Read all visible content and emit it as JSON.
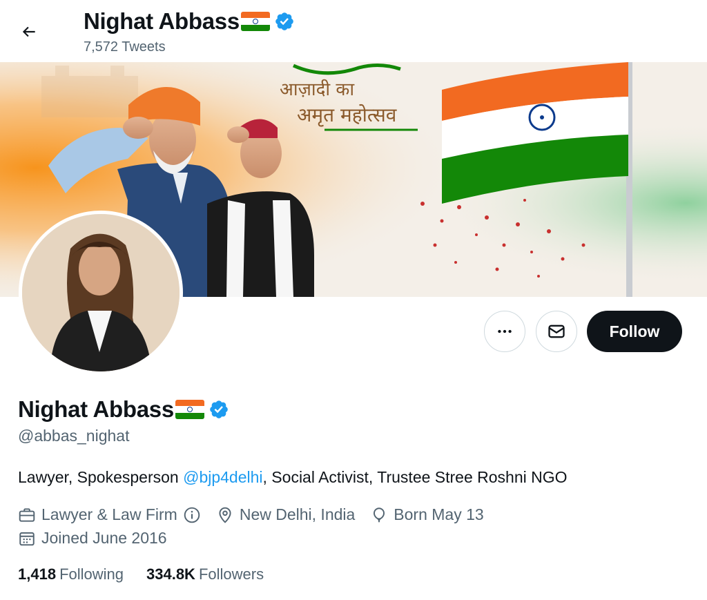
{
  "header": {
    "name": "Nighat Abbass",
    "tweet_count": "7,572 Tweets"
  },
  "banner": {
    "caption_line1": "आज़ादी का",
    "caption_line2": "अमृत महोत्सव"
  },
  "profile": {
    "name": "Nighat Abbass",
    "handle": "@abbas_nighat",
    "bio_before": "Lawyer, Spokesperson ",
    "bio_mention": "@bjp4delhi",
    "bio_after": ", Social Activist, Trustee Stree Roshni NGO",
    "category": "Lawyer & Law Firm",
    "location": "New Delhi, India",
    "birthday": "Born May 13",
    "joined": "Joined June 2016"
  },
  "actions": {
    "follow_label": "Follow"
  },
  "stats": {
    "following_count": "1,418",
    "following_label": "Following",
    "followers_count": "334.8K",
    "followers_label": "Followers"
  },
  "colors": {
    "accent": "#1d9bf0",
    "text_primary": "#0f1419",
    "text_secondary": "#536471",
    "saffron": "#f26a21",
    "india_green": "#138808"
  },
  "icons": {
    "back": "arrow-left-icon",
    "verified": "verified-badge-icon",
    "more": "more-dots-icon",
    "message": "envelope-icon",
    "category": "briefcase-icon",
    "info": "info-icon",
    "location": "location-pin-icon",
    "birthday": "balloon-icon",
    "joined": "calendar-icon"
  }
}
